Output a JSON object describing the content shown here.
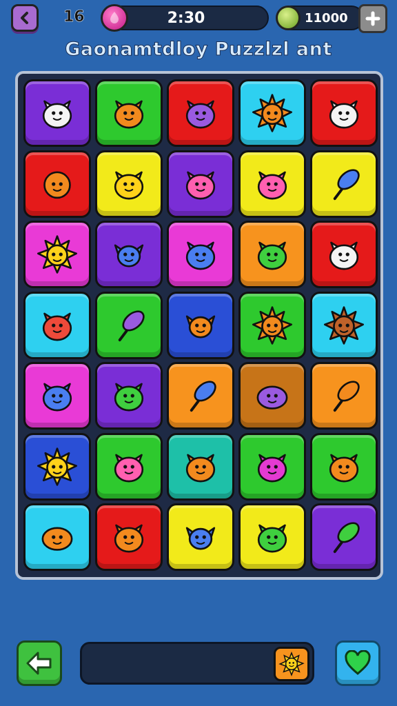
{
  "header": {
    "level": "16",
    "timer": "2:30",
    "coins": "11000",
    "title": "Gaonamtdloy Puzzlzl ant"
  },
  "colors": {
    "purple": "#7a2ed6",
    "green": "#2ec92e",
    "red": "#e51a1a",
    "cyan": "#2ed0f0",
    "yellow": "#f2ea1a",
    "magenta": "#e93ad6",
    "orange": "#f7931e",
    "blue": "#2a4fd6",
    "teal": "#1ec0a8",
    "brown": "#c77418"
  },
  "board": {
    "tiles": [
      [
        {
          "color": "purple",
          "icon": "white-cat-icon"
        },
        {
          "color": "green",
          "icon": "orange-cat-icon"
        },
        {
          "color": "red",
          "icon": "purple-spiky-monster-icon"
        },
        {
          "color": "cyan",
          "icon": "orange-sun-icon"
        },
        {
          "color": "red",
          "icon": "white-robot-cat-icon"
        }
      ],
      [
        {
          "color": "red",
          "icon": "campfire-icon"
        },
        {
          "color": "yellow",
          "icon": "yellow-cat-icon"
        },
        {
          "color": "purple",
          "icon": "pink-cat-icon"
        },
        {
          "color": "yellow",
          "icon": "pink-cat-icon"
        },
        {
          "color": "yellow",
          "icon": "blue-cone-icon"
        }
      ],
      [
        {
          "color": "magenta",
          "icon": "yellow-sun-icon"
        },
        {
          "color": "purple",
          "icon": "blue-bird-icon"
        },
        {
          "color": "magenta",
          "icon": "blue-bear-icon"
        },
        {
          "color": "orange",
          "icon": "green-leaf-monster-icon"
        },
        {
          "color": "red",
          "icon": "white-robot-cat-icon"
        }
      ],
      [
        {
          "color": "cyan",
          "icon": "red-cat-icon"
        },
        {
          "color": "green",
          "icon": "purple-popsicle-icon"
        },
        {
          "color": "blue",
          "icon": "orange-bird-icon"
        },
        {
          "color": "green",
          "icon": "orange-sun-cat-icon"
        },
        {
          "color": "cyan",
          "icon": "brown-sun-bear-icon"
        }
      ],
      [
        {
          "color": "magenta",
          "icon": "blue-cat-icon"
        },
        {
          "color": "purple",
          "icon": "green-cat-icon"
        },
        {
          "color": "orange",
          "icon": "blue-leaf-icon"
        },
        {
          "color": "brown",
          "icon": "purple-blob-icon"
        },
        {
          "color": "orange",
          "icon": "orange-leaf-icon"
        }
      ],
      [
        {
          "color": "blue",
          "icon": "yellow-sun-icon"
        },
        {
          "color": "green",
          "icon": "pink-bear-icon"
        },
        {
          "color": "teal",
          "icon": "orange-bear-icon"
        },
        {
          "color": "green",
          "icon": "magenta-cat-icon"
        },
        {
          "color": "green",
          "icon": "orange-bear-icon"
        }
      ],
      [
        {
          "color": "cyan",
          "icon": "orange-shell-icon"
        },
        {
          "color": "red",
          "icon": "orange-bear-icon"
        },
        {
          "color": "yellow",
          "icon": "blue-fish-icon"
        },
        {
          "color": "yellow",
          "icon": "green-frog-icon"
        },
        {
          "color": "purple",
          "icon": "green-lollipop-icon"
        }
      ]
    ]
  },
  "bottom": {
    "undo_icon": "back-arrow-icon",
    "tray_tile": {
      "color": "orange",
      "icon": "yellow-sun-icon"
    },
    "heart_icon": "green-heart-icon"
  }
}
